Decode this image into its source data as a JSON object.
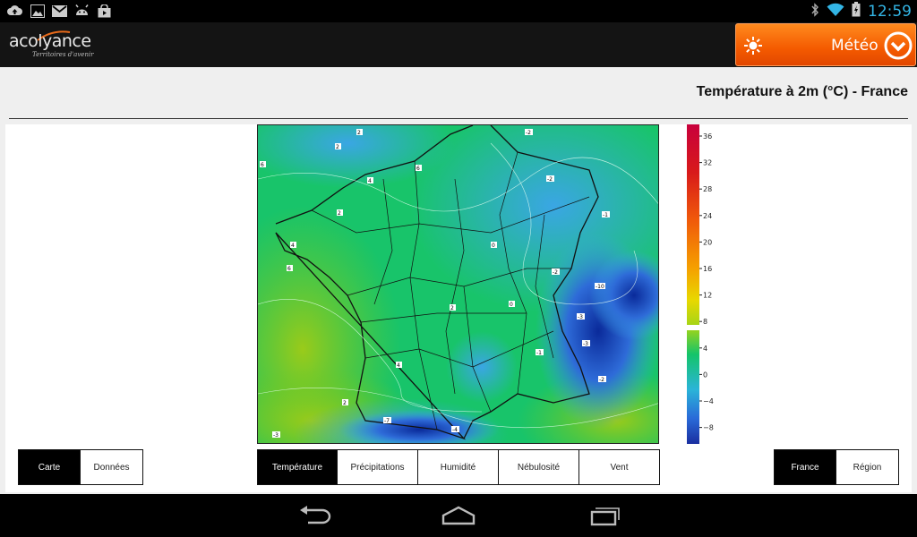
{
  "status_bar": {
    "time": "12:59",
    "icons": [
      "cloud-upload-icon",
      "image-icon",
      "gmail-icon",
      "android-icon",
      "shopping-bag-icon",
      "bluetooth-icon",
      "wifi-icon",
      "battery-icon"
    ]
  },
  "header": {
    "logo_text": "acolyance",
    "logo_tagline": "Territoires d'avenir",
    "meteo_label": "Météo"
  },
  "page_title": "Température à 2m (°C) - France",
  "colors": {
    "accent_orange": "#f45a00",
    "scale_low": "#1a3fc9",
    "scale_mid": "#12c46a",
    "scale_high": "#c8003c"
  },
  "scale": {
    "ticks": [
      "36",
      "32",
      "28",
      "24",
      "20",
      "16",
      "12",
      "8",
      "4",
      "0",
      "−4",
      "−8"
    ]
  },
  "map_labels": [
    {
      "t": "-2"
    },
    {
      "t": "2"
    },
    {
      "t": "2"
    },
    {
      "t": "6"
    },
    {
      "t": "6"
    },
    {
      "t": "4"
    },
    {
      "t": "2"
    },
    {
      "t": "4"
    },
    {
      "t": "-2"
    },
    {
      "t": "-1"
    },
    {
      "t": "0"
    },
    {
      "t": "-2"
    },
    {
      "t": "2"
    },
    {
      "t": "0"
    },
    {
      "t": "-3"
    },
    {
      "t": "-1"
    },
    {
      "t": "6"
    },
    {
      "t": "-3"
    },
    {
      "t": "-2"
    },
    {
      "t": "4"
    },
    {
      "t": "-10"
    },
    {
      "t": "-4"
    },
    {
      "t": "2"
    },
    {
      "t": "-7"
    },
    {
      "t": "-3"
    }
  ],
  "view_toggle": {
    "carte": "Carte",
    "donnees": "Données"
  },
  "variables": {
    "temperature": "Température",
    "precipitations": "Précipitations",
    "humidite": "Humidité",
    "nebulosite": "Nébulosité",
    "vent": "Vent"
  },
  "zone_toggle": {
    "france": "France",
    "region": "Région"
  }
}
